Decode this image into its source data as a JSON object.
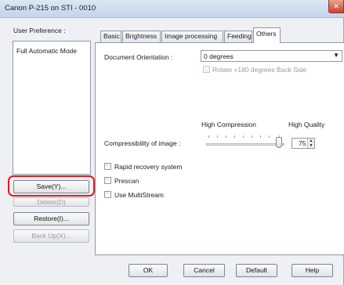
{
  "window": {
    "title": "Canon P-215 on STI - 0010",
    "close_symbol": "✕"
  },
  "left_panel": {
    "label": "User Preference :",
    "list_items": [
      "Full Automatic Mode"
    ],
    "buttons": {
      "save": "Save(Y)...",
      "delete": "Delete(D)",
      "restore": "Restore(I)...",
      "backup": "Back Up(X)..."
    }
  },
  "tabs": [
    {
      "label": "Basic"
    },
    {
      "label": "Brightness"
    },
    {
      "label": "Image processing"
    },
    {
      "label": "Feeding"
    },
    {
      "label": "Others"
    }
  ],
  "active_tab": "Others",
  "others": {
    "orientation_label": "Document Orientation :",
    "orientation_value": "0 degrees",
    "rotate_label": "Rotate +180 degrees Back Side",
    "compression_high": "High Compression",
    "quality_high": "High Quality",
    "compressibility_label": "Compressibility of image :",
    "compressibility_value": "75",
    "rapid_recovery_label": "Rapid recovery system",
    "prescan_label": "Prescan",
    "multistream_label": "Use MultiStream"
  },
  "footer": {
    "ok": "OK",
    "cancel": "Cancel",
    "default": "Default",
    "help": "Help"
  }
}
